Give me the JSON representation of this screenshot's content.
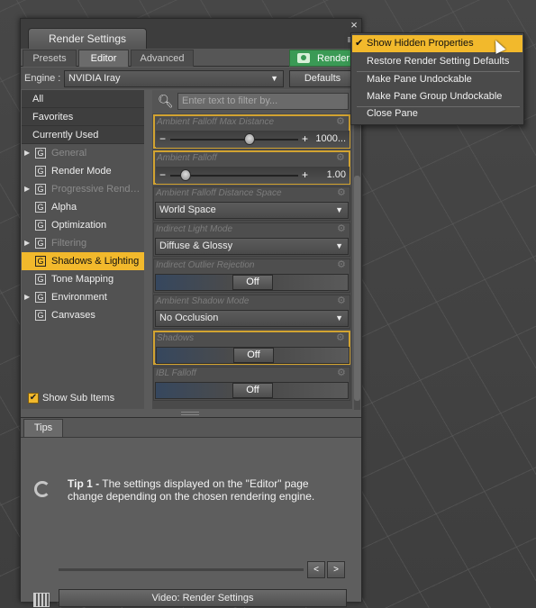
{
  "pane": {
    "title": "Render Settings",
    "close_glyph": "×",
    "menu_glyph": "≡"
  },
  "subtabs": [
    "Presets",
    "Editor",
    "Advanced"
  ],
  "render_button": "Render",
  "engine": {
    "label": "Engine :",
    "value": "NVIDIA Iray",
    "defaults_label": "Defaults"
  },
  "categories": [
    {
      "label": "All",
      "kind": "flat"
    },
    {
      "label": "Favorites",
      "kind": "flat"
    },
    {
      "label": "Currently Used",
      "kind": "flat"
    },
    {
      "label": "General",
      "kind": "group",
      "dim": true,
      "expandable": true
    },
    {
      "label": "Render Mode",
      "kind": "group",
      "dim": false,
      "expandable": false
    },
    {
      "label": "Progressive Rend…",
      "kind": "group",
      "dim": true,
      "expandable": true
    },
    {
      "label": "Alpha",
      "kind": "group",
      "dim": false,
      "expandable": false
    },
    {
      "label": "Optimization",
      "kind": "group",
      "dim": false,
      "expandable": false
    },
    {
      "label": "Filtering",
      "kind": "group",
      "dim": true,
      "expandable": true
    },
    {
      "label": "Shadows & Lighting",
      "kind": "group",
      "dim": false,
      "expandable": false,
      "selected": true
    },
    {
      "label": "Tone Mapping",
      "kind": "group",
      "dim": false,
      "expandable": false
    },
    {
      "label": "Environment",
      "kind": "group",
      "dim": false,
      "expandable": true
    },
    {
      "label": "Canvases",
      "kind": "group",
      "dim": false,
      "expandable": false
    }
  ],
  "group_glyph": "G",
  "expand_glyph": "▶",
  "show_sub_items": {
    "label": "Show Sub Items",
    "checked": true,
    "check_glyph": "✔"
  },
  "filter": {
    "placeholder": "Enter text to filter by...",
    "icon": "search-icon"
  },
  "properties": [
    {
      "label": "Ambient Falloff Max Distance",
      "type": "slider",
      "value": "1000...",
      "fraction": 0.62,
      "highlighted": true
    },
    {
      "label": "Ambient Falloff",
      "type": "slider",
      "value": "1.00",
      "fraction": 0.12,
      "highlighted": true
    },
    {
      "label": "Ambient Falloff Distance Space",
      "type": "dropdown",
      "value": "World Space",
      "highlighted": false
    },
    {
      "label": "Indirect Light Mode",
      "type": "dropdown",
      "value": "Diffuse & Glossy",
      "highlighted": false
    },
    {
      "label": "Indirect Outlier Rejection",
      "type": "toggle",
      "value": "Off",
      "highlighted": false
    },
    {
      "label": "Ambient Shadow Mode",
      "type": "dropdown",
      "value": "No Occlusion",
      "highlighted": false
    },
    {
      "label": "Shadows",
      "type": "toggle",
      "value": "Off",
      "highlighted": true
    },
    {
      "label": "IBL Falloff",
      "type": "toggle",
      "value": "Off",
      "highlighted": false
    }
  ],
  "tips": {
    "tab_label": "Tips",
    "tip_title": "Tip 1 -",
    "tip_body": "The settings displayed on the \"Editor\" page change depending on the chosen rendering engine.",
    "prev_glyph": "<",
    "next_glyph": ">",
    "video_button": "Video: Render Settings"
  },
  "context_menu": {
    "items": [
      {
        "label": "Show Hidden Properties",
        "checked": true,
        "active": true
      },
      {
        "label": "Restore Render Setting Defaults",
        "checked": false,
        "active": false
      },
      {
        "label": "Make Pane Undockable",
        "checked": false,
        "active": false
      },
      {
        "label": "Make Pane Group Undockable",
        "checked": false,
        "active": false
      },
      {
        "label": "Close Pane",
        "checked": false,
        "active": false
      }
    ],
    "check_glyph": "✔"
  },
  "colors": {
    "accent": "#f2b92c",
    "render_green": "#3a9a55",
    "highlight_border": "#d2a331"
  }
}
